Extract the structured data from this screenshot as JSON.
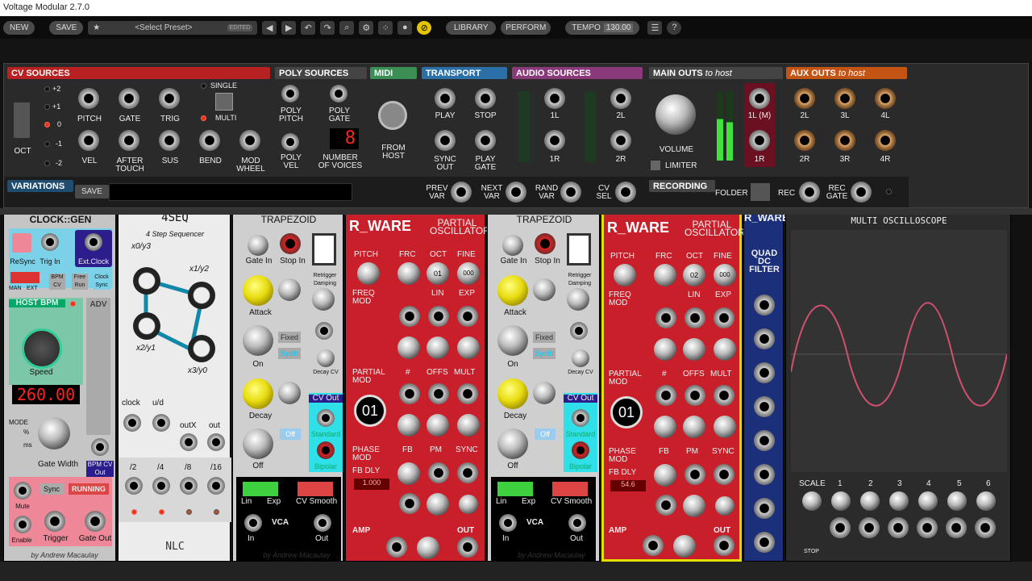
{
  "app": {
    "title": "Voltage Modular 2.7.0"
  },
  "toolbar": {
    "new": "NEW",
    "save": "SAVE",
    "preset": "<Select Preset>",
    "edited": "EDITED",
    "library": "LIBRARY",
    "perform": "PERFORM",
    "tempo_label": "TEMPO",
    "tempo_value": "130.00"
  },
  "cv_sources": {
    "title": "CV SOURCES",
    "oct_values": [
      "+2",
      "+1",
      "0",
      "-1",
      "-2"
    ],
    "oct_label": "OCT",
    "pitch": "PITCH",
    "gate": "GATE",
    "trig": "TRIG",
    "single": "SINGLE",
    "multi": "MULTI",
    "vel": "VEL",
    "after_touch": "AFTER TOUCH",
    "sus": "SUS",
    "bend": "BEND",
    "mod_wheel": "MOD WHEEL"
  },
  "poly_sources": {
    "title": "POLY SOURCES",
    "poly_pitch": "POLY PITCH",
    "poly_gate": "POLY GATE",
    "poly_vel": "POLY VEL",
    "voices_label": "NUMBER OF VOICES",
    "voices_value": "8"
  },
  "midi": {
    "title": "MIDI",
    "from_host": "FROM HOST"
  },
  "transport": {
    "title": "TRANSPORT",
    "play": "PLAY",
    "stop": "STOP",
    "sync_out": "SYNC OUT",
    "play_gate": "PLAY GATE"
  },
  "audio_sources": {
    "title": "AUDIO SOURCES",
    "l1": "1L",
    "l2": "2L",
    "r1": "1R",
    "r2": "2R"
  },
  "main_outs": {
    "title": "MAIN OUTS",
    "suffix": "to host",
    "volume": "VOLUME",
    "limiter": "LIMITER",
    "l1m": "1L (M)",
    "r1": "1R"
  },
  "aux_outs": {
    "title": "AUX OUTS",
    "suffix": "to host",
    "labels": [
      "2L",
      "3L",
      "4L",
      "2R",
      "3R",
      "4R"
    ]
  },
  "variations": {
    "title": "VARIATIONS",
    "save": "SAVE",
    "prev": "PREV VAR",
    "next": "NEXT VAR",
    "rand": "RAND VAR",
    "cvsel": "CV SEL"
  },
  "recording": {
    "title": "RECORDING",
    "folder": "FOLDER",
    "rec": "REC",
    "rec_gate": "REC GATE"
  },
  "clock": {
    "title": "CLOCK::GEN",
    "resync": "ReSync",
    "trig_in": "Trig In",
    "ext_clock": "Ext.Clock",
    "man": "MAN",
    "ext": "EXT",
    "bpm_cv": "BPM CV",
    "free_run": "Free Run",
    "clock_sync": "Clock Sync",
    "host_bpm": "HOST BPM",
    "adv": "ADV",
    "speed": "Speed",
    "display": "260.00",
    "mode": "MODE",
    "pct": "%",
    "ms": "ms",
    "gate_width": "Gate Width",
    "bpm_cv_out": "BPM CV Out",
    "mute": "Mute",
    "sync": "Sync",
    "running": "RUNNING",
    "enable": "Enable",
    "trigger": "Trigger",
    "gate_out": "Gate Out",
    "credit": "by Andrew Macaulay"
  },
  "seq": {
    "title": "4SEQ",
    "subtitle": "4 Step Sequencer",
    "x0y3": "x0/y3",
    "x1y2": "x1/y2",
    "x2y1": "x2/y1",
    "x3y0": "x3/y0",
    "clock": "clock",
    "ud": "u/d",
    "outx": "outX",
    "out": "out",
    "divs": [
      "/2",
      "/4",
      "/8",
      "/16"
    ],
    "brand": "NLC"
  },
  "trap": {
    "title": "TRAPEZOID",
    "gate_in": "Gate In",
    "stop_in": "Stop In",
    "retrigger": "Retrigger Damping",
    "attack": "Attack",
    "fixed": "Fixed",
    "synth": "Synth",
    "on": "On",
    "decay_cv": "Decay CV",
    "decay": "Decay",
    "cv_out": "CV Out",
    "off_btn": "Off",
    "standard": "Standard",
    "off": "Off",
    "bipolar": "Bipolar",
    "lin": "Lin",
    "exp": "Exp",
    "cv_smooth": "CV Smooth",
    "vca": "VCA",
    "in": "In",
    "out": "Out",
    "credit": "by Andrew Macaulay"
  },
  "partial": {
    "brand": "R_WARE",
    "title": "PARTIAL OSCILLATOR",
    "pitch": "PITCH",
    "frc": "FRC",
    "oct": "OCT",
    "fine": "FINE",
    "freq_mod": "FREQ MOD",
    "lin": "LIN",
    "exp": "EXP",
    "partial_mod": "PARTIAL MOD",
    "hash": "#",
    "offs": "OFFS",
    "mult": "MULT",
    "phase_mod": "PHASE MOD",
    "fb": "FB",
    "pm": "PM",
    "sync": "SYNC",
    "fb_dly": "FB DLY",
    "amp": "AMP",
    "out": "OUT",
    "partial_display": "01",
    "oct_a": "01",
    "oct_b": "02",
    "fine_val": "000",
    "dly_a": "1.000",
    "dly_b": "54.6"
  },
  "filter": {
    "brand": "R_WARE",
    "title": "QUAD DC FILTER"
  },
  "scope": {
    "title": "MULTI OSCILLOSCOPE",
    "scale": "SCALE",
    "channels": [
      "1",
      "2",
      "3",
      "4",
      "5",
      "6"
    ],
    "stop": "STOP"
  }
}
